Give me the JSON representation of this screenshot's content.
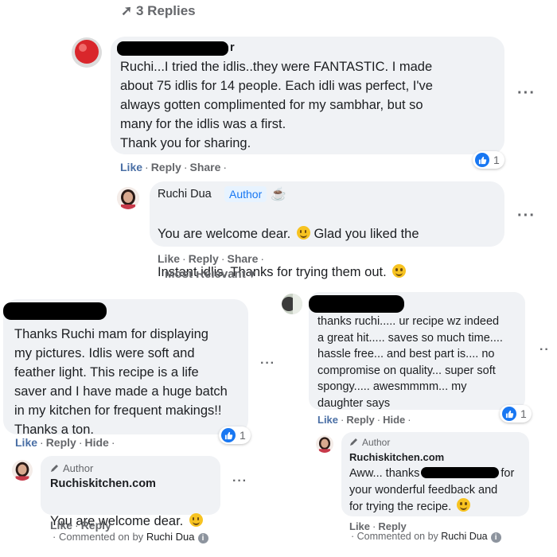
{
  "top_thread": {
    "replies_label": "3 Replies",
    "comment1": {
      "name_tail": "r",
      "lines": "Ruchi...I tried the idlis..they were FANTASTIC. I made\nabout 75 idlis for 14 people. Each idli was perfect, I've\nalways gotten complimented for my sambhar, but so\nmany for the idlis was a first.\nThank you for sharing.",
      "like": "Like",
      "reply": "Reply",
      "share": "Share",
      "reaction_count": "1"
    },
    "reply1": {
      "name": "Ruchi Dua",
      "badge": "Author",
      "lines": "You are welcome dear. \u0000 Glad you liked the\nInstant idlis. Thanks for trying them out.",
      "line1a": "You are welcome dear.",
      "line1b": "Glad you liked the",
      "line2": "Instant idlis. Thanks for trying them out.",
      "like": "Like",
      "reply": "Reply",
      "share": "Share"
    },
    "sort_label": "Most Relevant"
  },
  "left_thread": {
    "comment": {
      "lines": "Thanks Ruchi mam for displaying\nmy pictures. Idlis were soft and\nfeather light. This recipe is a life\nsaver and I have made a huge batch\nin my kitchen for frequent makings!!\nThanks a ton.",
      "like": "Like",
      "reply": "Reply",
      "hide": "Hide",
      "reaction_count": "1"
    },
    "reply": {
      "badge": "Author",
      "name": "Ruchiskitchen.com",
      "text": "You are welcome dear.",
      "like": "Like",
      "reply": "Reply",
      "commented_by_prefix": "Commented on by",
      "commented_by_name": "Ruchi Dua"
    }
  },
  "right_thread": {
    "comment": {
      "lines": "thanks ruchi..... ur recipe wz indeed\na great hit..... saves so much time....\nhassle free... and best part is.... no\ncompromise on quality... super soft\nspongy..... awesmmmm... my\ndaughter says",
      "like": "Like",
      "reply": "Reply",
      "hide": "Hide",
      "reaction_count": "1"
    },
    "reply": {
      "badge": "Author",
      "name": "Ruchiskitchen.com",
      "line1a": "Aww... thanks",
      "line1b": "for",
      "line2": "your wonderful feedback and",
      "line3": "for trying the recipe.",
      "like": "Like",
      "reply": "Reply",
      "commented_by_prefix": "Commented on by",
      "commented_by_name": "Ruchi Dua"
    }
  },
  "colors": {
    "bubble": "#f0f2f5",
    "link_blue": "#4a6fa5",
    "author_badge_bg": "#e7f3ff",
    "author_badge_text": "#1877f2",
    "like_blue": "#1877f2"
  }
}
